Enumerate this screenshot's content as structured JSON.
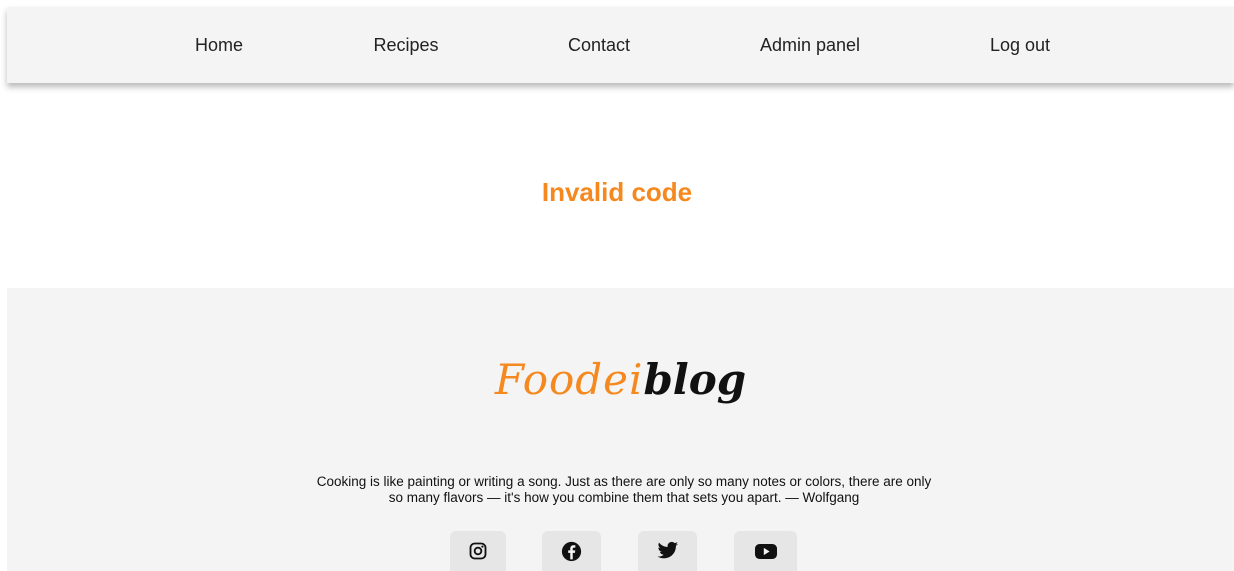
{
  "nav": {
    "items": [
      {
        "label": "Home"
      },
      {
        "label": "Recipes"
      },
      {
        "label": "Contact"
      },
      {
        "label": "Admin panel"
      },
      {
        "label": "Log out"
      }
    ]
  },
  "main": {
    "message": "Invalid code"
  },
  "footer": {
    "logo": {
      "part1": "Foodei",
      "part2": "blog"
    },
    "quote": "Cooking is like painting or writing a song. Just as there are only so many notes or colors, there are only so many flavors — it's how you combine them that sets you apart. — Wolfgang",
    "social": [
      {
        "icon": "instagram-icon"
      },
      {
        "icon": "facebook-icon"
      },
      {
        "icon": "twitter-icon"
      },
      {
        "icon": "youtube-icon"
      }
    ]
  },
  "colors": {
    "accent": "#f5891f",
    "nav_background": "#f4f4f4",
    "footer_background": "#f4f4f4",
    "social_button_background": "#e6e6e6"
  }
}
